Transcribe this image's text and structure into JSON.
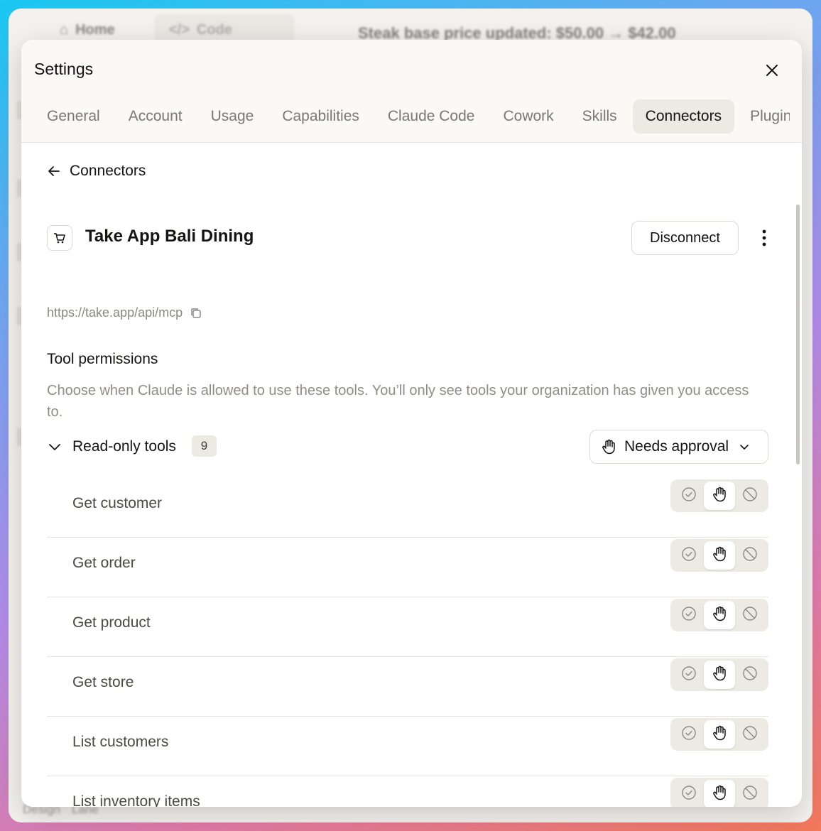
{
  "background_app": {
    "tabs": [
      {
        "label": "Home",
        "icon": "home-icon"
      },
      {
        "label": "Code",
        "icon": "code-icon"
      }
    ],
    "headline": "Steak base price updated: $50.00 → $42.00",
    "footer": {
      "label": "Design",
      "sublabel": "Lane"
    }
  },
  "modal": {
    "title": "Settings",
    "tabs": [
      {
        "label": "General"
      },
      {
        "label": "Account"
      },
      {
        "label": "Usage"
      },
      {
        "label": "Capabilities"
      },
      {
        "label": "Claude Code"
      },
      {
        "label": "Cowork"
      },
      {
        "label": "Skills"
      },
      {
        "label": "Connectors",
        "active": true
      },
      {
        "label": "Plugins"
      }
    ]
  },
  "page": {
    "back_label": "Connectors",
    "connector": {
      "name": "Take App Bali Dining",
      "icon": "cart-icon",
      "url": "https://take.app/api/mcp",
      "disconnect_label": "Disconnect"
    },
    "permissions": {
      "title": "Tool permissions",
      "description": "Choose when Claude is allowed to use these tools. You’ll only see tools your organization has given you access to.",
      "group": {
        "label": "Read-only tools",
        "count": "9",
        "approval_label": "Needs approval",
        "approval_icon": "hand-icon"
      },
      "tools": [
        {
          "name": "Get customer",
          "mode": "needs-approval"
        },
        {
          "name": "Get order",
          "mode": "needs-approval"
        },
        {
          "name": "Get product",
          "mode": "needs-approval"
        },
        {
          "name": "Get store",
          "mode": "needs-approval"
        },
        {
          "name": "List customers",
          "mode": "needs-approval"
        },
        {
          "name": "List inventory items",
          "mode": "needs-approval"
        }
      ]
    }
  },
  "colors": {
    "text_primary": "#141413",
    "text_muted": "#8f8d87",
    "segment_bg": "#eceae3",
    "header_bg": "#faf9f5"
  }
}
